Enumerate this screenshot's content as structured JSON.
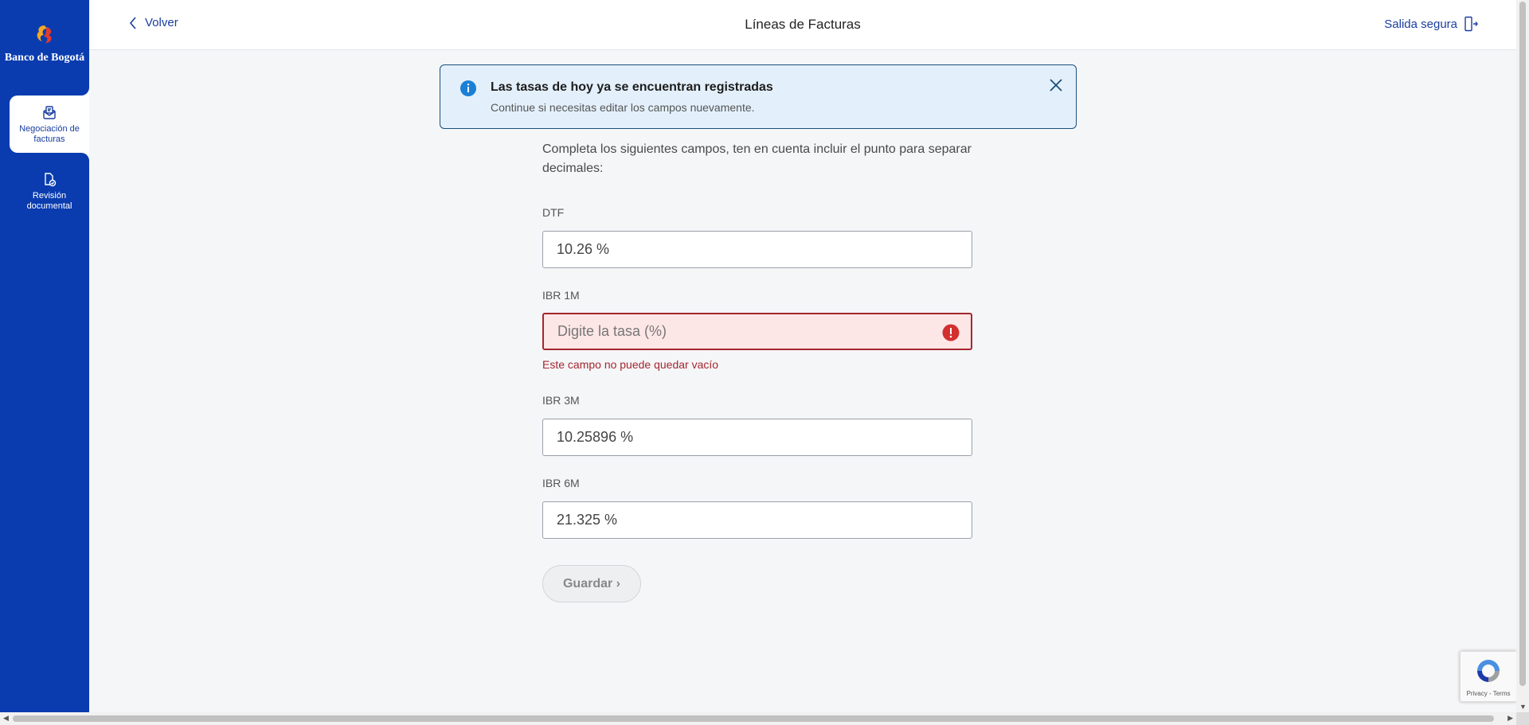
{
  "sidebar": {
    "logo_text": "Banco de Bogotá",
    "items": [
      {
        "label": "Negociación de facturas",
        "icon": "invoice-envelope-icon",
        "active": true
      },
      {
        "label": "Revisión documental",
        "icon": "document-check-icon",
        "active": false
      }
    ]
  },
  "header": {
    "back_label": "Volver",
    "title": "Líneas de Facturas",
    "exit_label": "Salida segura"
  },
  "alert": {
    "title": "Las tasas de hoy ya se encuentran registradas",
    "message": "Continue si necesitas editar los campos nuevamente."
  },
  "form": {
    "intro": "Completa los siguientes campos, ten en cuenta incluir el punto para separar decimales:",
    "fields": [
      {
        "label": "DTF",
        "value": "10.26 %",
        "placeholder": ""
      },
      {
        "label": "IBR 1M",
        "value": "",
        "placeholder": "Digite la tasa (%)",
        "error": "Este campo no puede quedar vacío"
      },
      {
        "label": "IBR 3M",
        "value": "10.25896 %",
        "placeholder": ""
      },
      {
        "label": "IBR 6M",
        "value": "21.325 %",
        "placeholder": ""
      }
    ],
    "submit_label": "Guardar ›"
  },
  "recaptcha": {
    "privacy": "Privacy",
    "separator": " - ",
    "terms": "Terms"
  },
  "colors": {
    "brand": "#0a3cb0",
    "link": "#1a3e9e",
    "error": "#a5262f",
    "info": "#1a7fd6"
  }
}
